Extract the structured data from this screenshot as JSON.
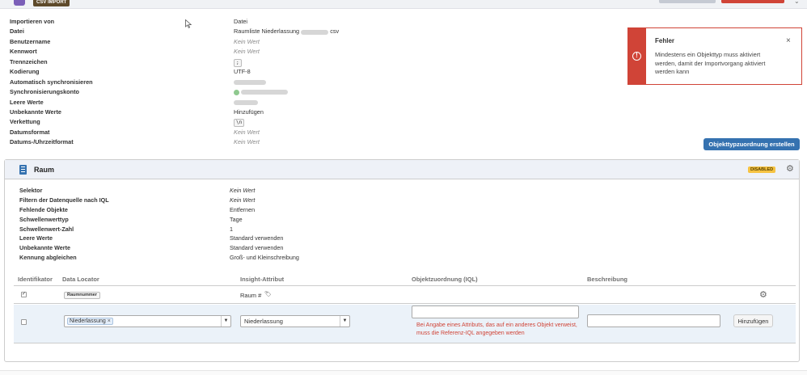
{
  "topbar": {
    "badge": "CSV IMPORT",
    "menu_chevron": "⌄"
  },
  "import_properties": [
    {
      "label": "Importieren von",
      "value": "Datei",
      "muted": false
    },
    {
      "label": "Datei",
      "value": "Raumliste Niederlassung",
      "value_suffix": "csv",
      "muted": false
    },
    {
      "label": "Benutzername",
      "value": "Kein Wert",
      "muted": true
    },
    {
      "label": "Kennwort",
      "value": "Kein Wert",
      "muted": true
    },
    {
      "label": "Trennzeichen",
      "value": ";",
      "muted": false
    },
    {
      "label": "Kodierung",
      "value": "UTF-8",
      "muted": false
    },
    {
      "label": "Automatisch synchronisieren",
      "value": "",
      "muted": false
    },
    {
      "label": "Synchronisierungskonto",
      "value": "",
      "muted": false
    },
    {
      "label": "Leere Werte",
      "value": "",
      "muted": false
    },
    {
      "label": "Unbekannte Werte",
      "value": "Hinzufügen",
      "muted": false
    },
    {
      "label": "Verkettung",
      "value": "\\n",
      "muted": false
    },
    {
      "label": "Datumsformat",
      "value": "Kein Wert",
      "muted": true
    },
    {
      "label": "Datums-/Uhrzeitformat",
      "value": "Kein Wert",
      "muted": true
    }
  ],
  "error_toast": {
    "title": "Fehler",
    "message": "Mindestens ein Objekttyp muss aktiviert werden, damit der Importvorgang aktiviert werden kann",
    "close": "×",
    "icon_glyph": "!"
  },
  "create_mapping_button": "Objekttypzuordnung erstellen",
  "panel": {
    "title": "Raum",
    "status_badge": "DISABLED",
    "settings_glyph": "⚙",
    "properties": [
      {
        "label": "Selektor",
        "value": "Kein Wert",
        "muted": true
      },
      {
        "label": "Filtern der Datenquelle nach IQL",
        "value": "Kein Wert",
        "muted": true
      },
      {
        "label": "Fehlende Objekte",
        "value": "Entfernen",
        "muted": false
      },
      {
        "label": "Schwellenwerttyp",
        "value": "Tage",
        "muted": false
      },
      {
        "label": "Schwellenwert-Zahl",
        "value": "1",
        "muted": false
      },
      {
        "label": "Leere Werte",
        "value": "Standard verwenden",
        "muted": false
      },
      {
        "label": "Unbekannte Werte",
        "value": "Standard verwenden",
        "muted": false
      },
      {
        "label": "Kennung abgleichen",
        "value": "Groß- und Kleinschreibung",
        "muted": false
      }
    ],
    "table": {
      "columns": [
        "Identifikator",
        "Data Locator",
        "Insight-Attribut",
        "Objektzuordnung (IQL)",
        "Beschreibung"
      ],
      "row1": {
        "identifier_checked": true,
        "check_glyph": "✓",
        "data_locator": "Raumnummer",
        "insight_attribute": "Raum #",
        "tag_glyph": "🏷",
        "settings_glyph": "⚙"
      },
      "row2": {
        "identifier_checked": false,
        "data_locator_chip": "Niederlassung",
        "chip_remove": "×",
        "dropdown_arrow": "▼",
        "insight_attribute": "Niederlassung",
        "iql_value": "",
        "error": "Bei Angabe eines Attributs, das auf ein anderes Objekt verweist, muss die Referenz-IQL angegeben werden",
        "description_value": "",
        "add_button": "Hinzufügen"
      }
    }
  }
}
